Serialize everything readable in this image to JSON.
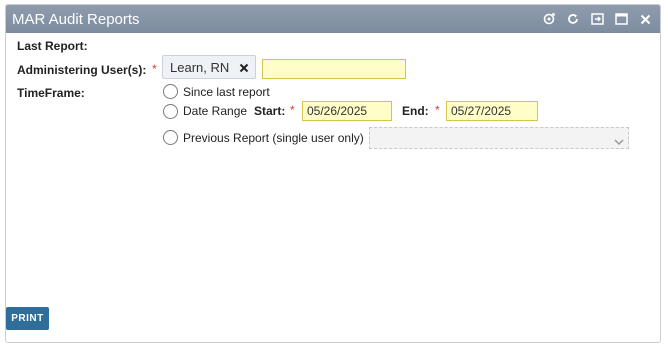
{
  "window": {
    "title": "MAR Audit Reports",
    "icons": [
      "refresh-alt-icon",
      "reload-icon",
      "expand-icon",
      "maximize-icon",
      "close-icon"
    ]
  },
  "form": {
    "last_report_label": "Last Report:",
    "admin_users_label": "Administering User(s):",
    "required_mark": "*",
    "selected_user": "Learn, RN",
    "user_search_value": "",
    "timeframe_label": "TimeFrame:",
    "options": {
      "since_last": "Since last report",
      "date_range": "Date Range",
      "previous_report": "Previous Report (single user only)"
    },
    "start_label": "Start:",
    "start_value": "05/26/2025",
    "end_label": "End:",
    "end_value": "05/27/2025",
    "previous_report_value": ""
  },
  "footer": {
    "print_label": "PRINT"
  },
  "colors": {
    "titlebar": "#8494a8",
    "required": "#d9393d",
    "input_bg": "#fffdc8",
    "print_btn": "#2f6d9b"
  }
}
